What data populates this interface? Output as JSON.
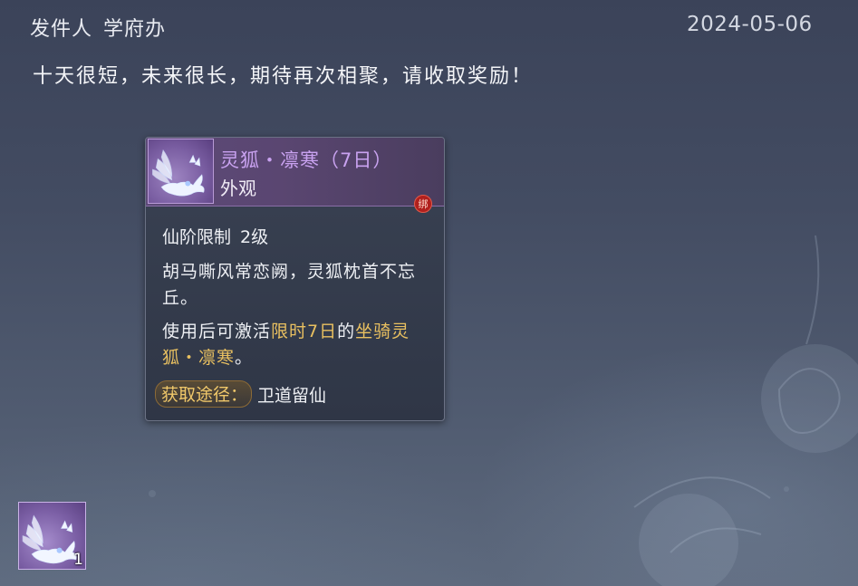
{
  "header": {
    "sender_label": "发件人",
    "sender_name": "学府办",
    "date": "2024-05-06"
  },
  "mail": {
    "body": "十天很短，未来很长，期待再次相聚，请收取奖励！"
  },
  "tooltip": {
    "item_name": "灵狐・凛寒（7日）",
    "item_type": "外观",
    "bind_badge": "绑",
    "level_label": "仙阶限制",
    "level_value": "2级",
    "description": "胡马嘶风常恋阙，灵狐枕首不忘丘。",
    "use_prefix": "使用后可激活",
    "use_highlight_1": "限时7日",
    "use_middle": "的",
    "use_highlight_2": "坐骑灵狐・凛寒",
    "use_suffix": "。",
    "source_label": "获取途径：",
    "source_value": "卫道留仙",
    "icon": "fox-mount-icon"
  },
  "attachment": {
    "icon": "fox-mount-icon",
    "count": "1"
  },
  "colors": {
    "rarity_purple": "#c9a2f0",
    "highlight_gold": "#e9c060",
    "bind_red": "#b0201d"
  }
}
